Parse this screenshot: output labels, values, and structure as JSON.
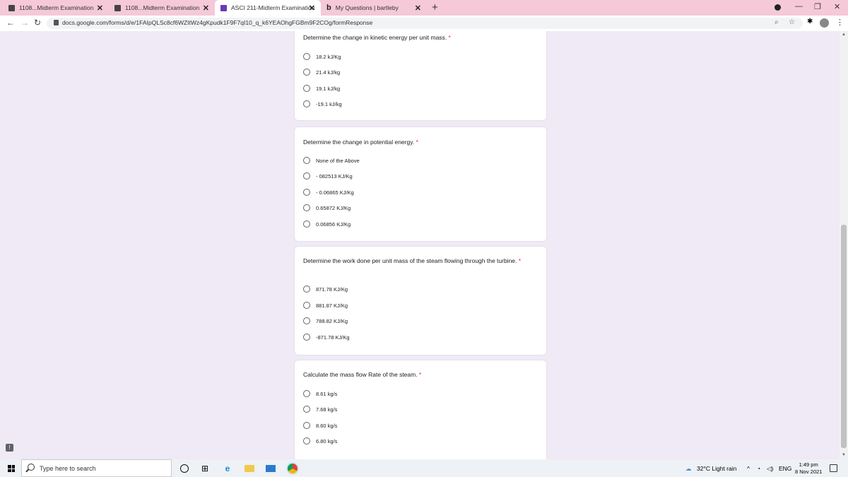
{
  "browser": {
    "tabs": [
      {
        "title": "1108...Midterm Examination",
        "active": false
      },
      {
        "title": "1108...Midterm Examination",
        "active": false
      },
      {
        "title": "ASCI 211-Midterm Examination",
        "active": true
      },
      {
        "title": "My Questions | bartleby",
        "active": false
      }
    ],
    "url": "docs.google.com/forms/d/e/1FAIpQLSc8cf6WZItWz4gKpudk1F9F7qI10_q_k6YEAOhgFGBm9F2COg/formResponse"
  },
  "form": {
    "required_mark": "*",
    "questions": [
      {
        "title": "Determine the change in kinetic energy per unit mass.",
        "options": [
          "18.2 kJ/Kg",
          "21.4 kJ/kg",
          "19.1 kJ/kg",
          "-19.1 kJ/kg"
        ]
      },
      {
        "title": "Determine the change in potential energy.",
        "options": [
          "None of the Above",
          "- 082513 KJ/Kg",
          "- 0.06865 KJ/Kg",
          "0.65872 KJ/Kg",
          "0.06856 KJ/Kg"
        ]
      },
      {
        "title": "Determine the work done per unit mass of the steam flowing through the turbine.",
        "options": [
          "871.78 KJ/Kg",
          "881.87 KJ/Kg",
          "788.82 KJ/Kg",
          "-871.78 KJ/Kg"
        ]
      },
      {
        "title": "Calculate the mass flow Rate of the steam.",
        "options": [
          "8.61 kg/s",
          "7.68 kg/s",
          "8.60 kg/s",
          "6.80 kg/s"
        ]
      }
    ]
  },
  "taskbar": {
    "search_placeholder": "Type here to search",
    "weather": "32°C  Light rain",
    "language": "ENG",
    "time": "1:49 pm",
    "date": "8 Nov 2021"
  },
  "colors": {
    "tabstrip": "#f5c9d7",
    "page_bg": "#efeaf6",
    "required": "#d93025"
  }
}
